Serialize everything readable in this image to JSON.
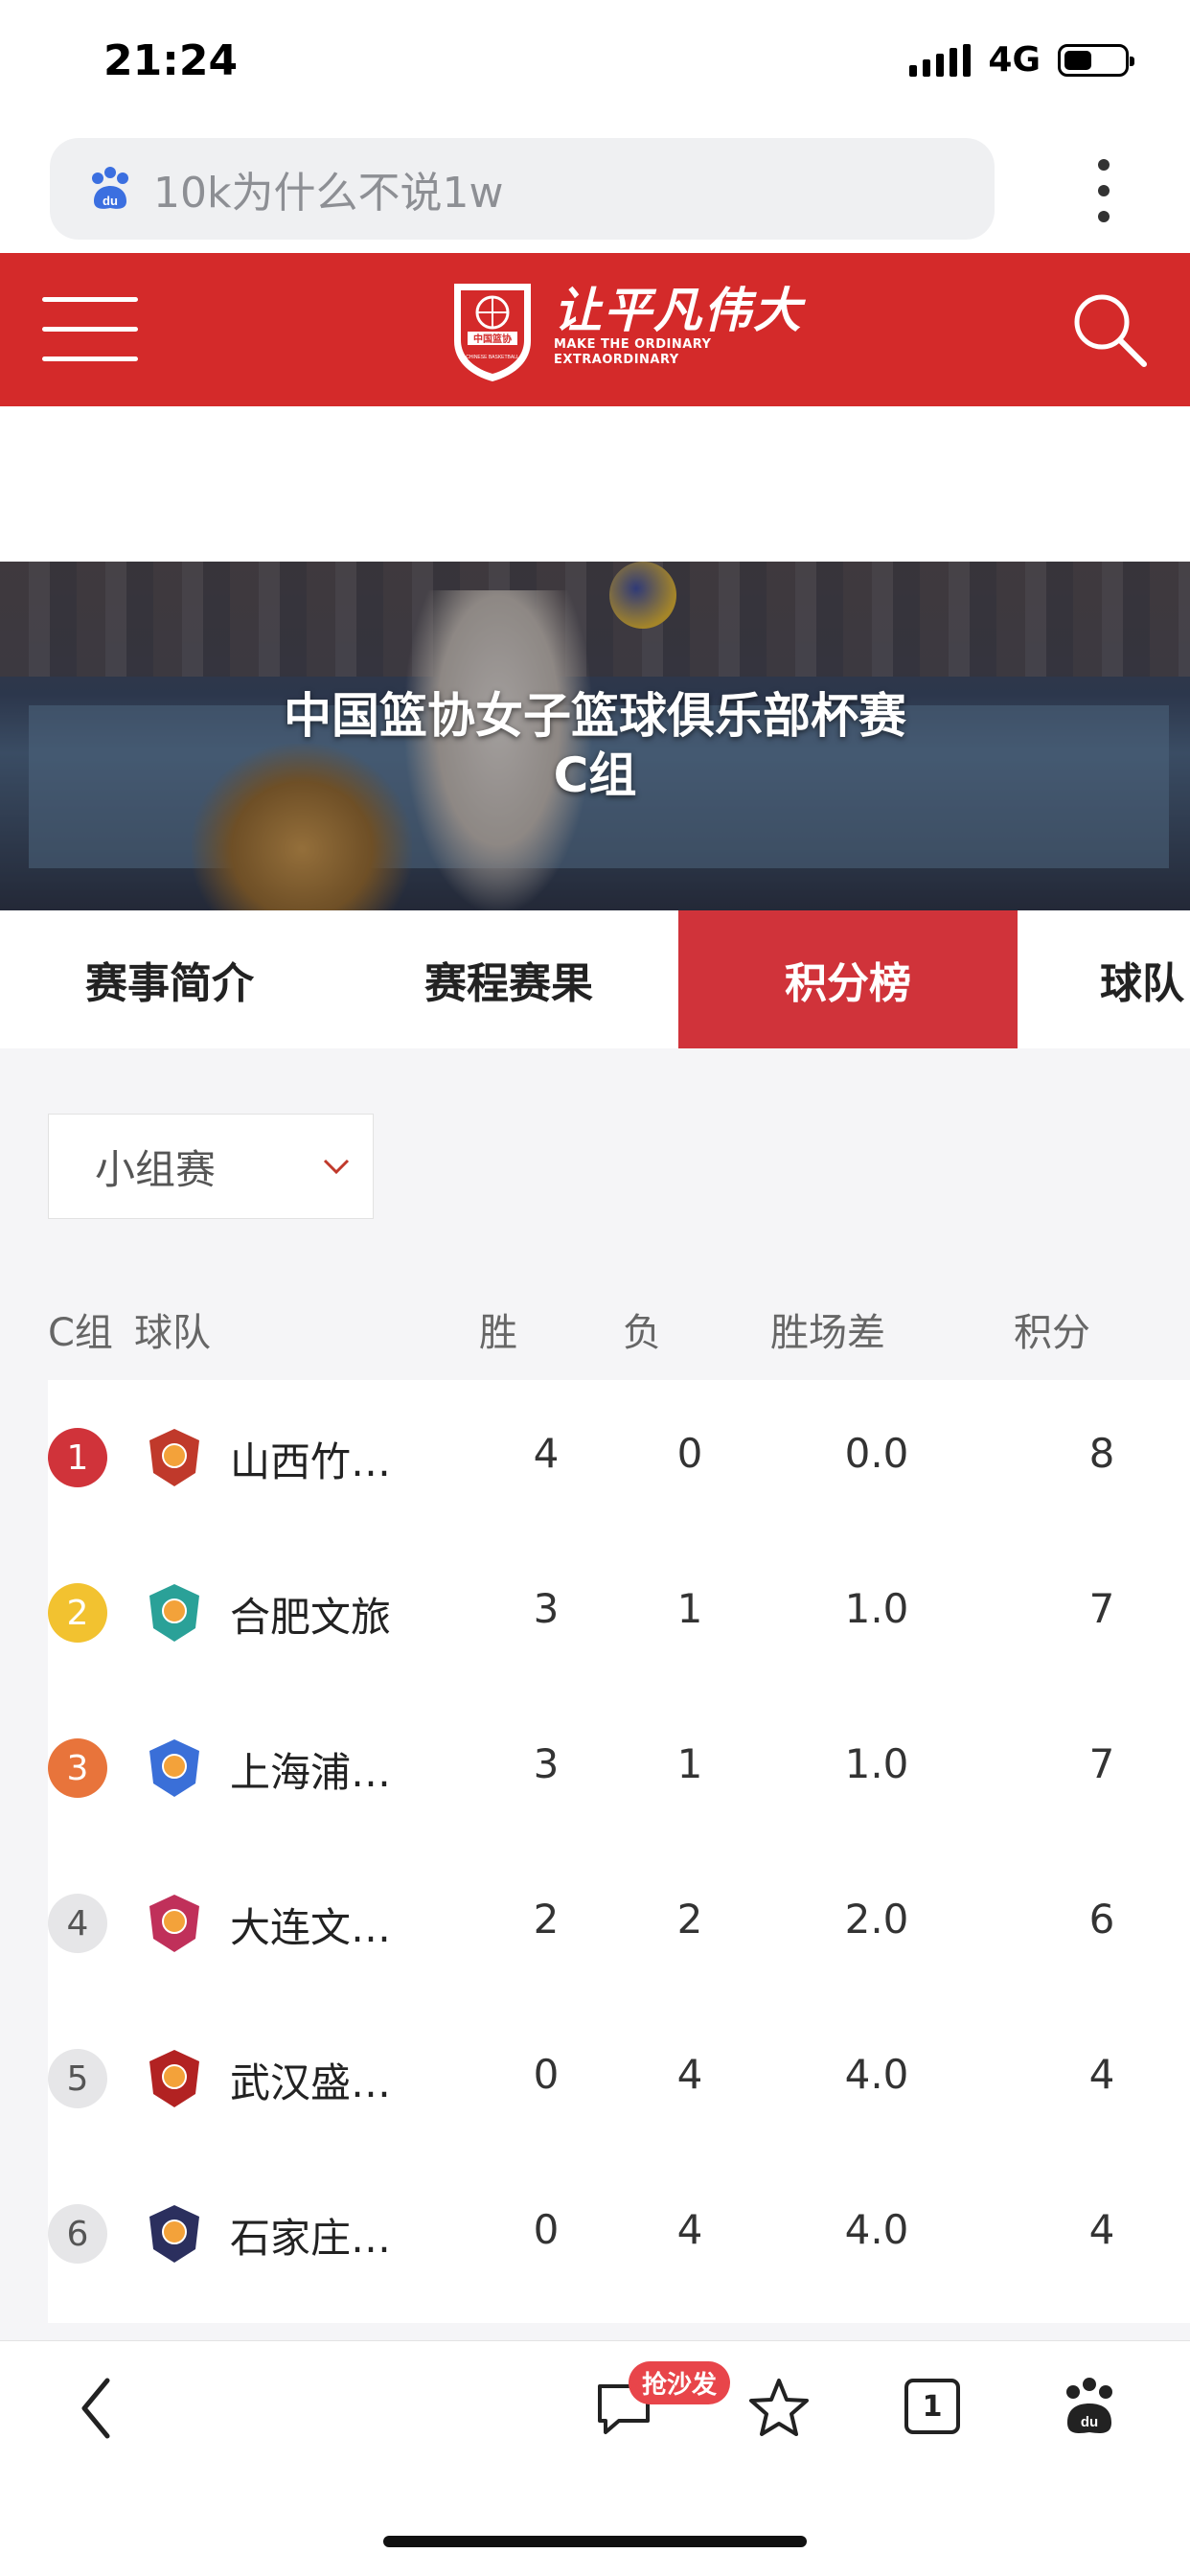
{
  "status_bar": {
    "time": "21:24",
    "network": "4G"
  },
  "search": {
    "query": "10k为什么不说1w",
    "paw_icon": "baidu-paw-icon"
  },
  "header": {
    "brand_color": "#d42a2a",
    "slogan_cn": "让平凡伟大",
    "slogan_en_1": "MAKE THE ORDINARY",
    "slogan_en_2": "EXTRAORDINARY",
    "badge_text": "中国篮协"
  },
  "banner": {
    "title_line1": "中国篮协女子篮球俱乐部杯赛",
    "title_line2": "C组"
  },
  "tabs": [
    {
      "label": "赛事简介",
      "active": false
    },
    {
      "label": "赛程赛果",
      "active": false
    },
    {
      "label": "积分榜",
      "active": true
    },
    {
      "label": "球队",
      "active": false
    }
  ],
  "filter": {
    "selected": "小组赛"
  },
  "table": {
    "headers": {
      "group": "C组",
      "team": "球队",
      "win": "胜",
      "loss": "负",
      "diff": "胜场差",
      "points": "积分"
    },
    "rows": [
      {
        "rank": "1",
        "team": "山西竹…",
        "win": "4",
        "loss": "0",
        "diff": "0.0",
        "points": "8",
        "rank_color": "#d0333a",
        "logo_color": "#c0392b"
      },
      {
        "rank": "2",
        "team": "合肥文旅",
        "win": "3",
        "loss": "1",
        "diff": "1.0",
        "points": "7",
        "rank_color": "#f2c230",
        "logo_color": "#2aa198"
      },
      {
        "rank": "3",
        "team": "上海浦…",
        "win": "3",
        "loss": "1",
        "diff": "1.0",
        "points": "7",
        "rank_color": "#e8743b",
        "logo_color": "#3a6fd8"
      },
      {
        "rank": "4",
        "team": "大连文…",
        "win": "2",
        "loss": "2",
        "diff": "2.0",
        "points": "6",
        "rank_color": "#e6e6e8",
        "logo_color": "#c0305a"
      },
      {
        "rank": "5",
        "team": "武汉盛…",
        "win": "0",
        "loss": "4",
        "diff": "4.0",
        "points": "4",
        "rank_color": "#e6e6e8",
        "logo_color": "#b22222"
      },
      {
        "rank": "6",
        "team": "石家庄…",
        "win": "0",
        "loss": "4",
        "diff": "4.0",
        "points": "4",
        "rank_color": "#e6e6e8",
        "logo_color": "#2b2f5e"
      }
    ]
  },
  "toolbar": {
    "comment_badge": "抢沙发",
    "tab_count": "1"
  }
}
